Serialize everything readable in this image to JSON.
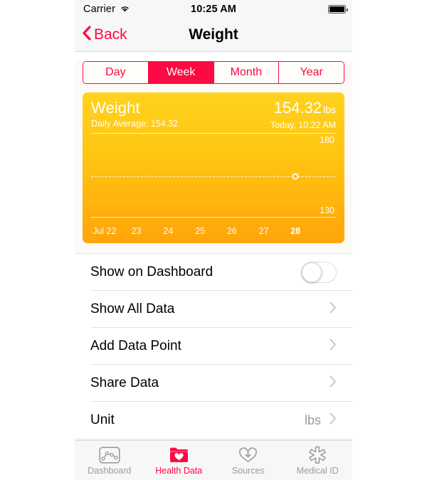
{
  "status_bar": {
    "carrier": "Carrier",
    "wifi_icon": "wifi-icon",
    "time": "10:25 AM",
    "battery_icon": "battery-full-icon"
  },
  "nav": {
    "back_label": "Back",
    "back_icon": "chevron-left-icon",
    "title": "Weight"
  },
  "segmented_control": {
    "selected": "Week",
    "options": [
      {
        "label": "Day"
      },
      {
        "label": "Week"
      },
      {
        "label": "Month"
      },
      {
        "label": "Year"
      }
    ]
  },
  "chart_card": {
    "title": "Weight",
    "subtitle": "Daily Average: 154.32",
    "value": "154.32",
    "unit": "lbs",
    "timestamp": "Today, 10:22 AM"
  },
  "chart_data": {
    "type": "scatter",
    "title": "Weight",
    "xlabel": "",
    "ylabel": "lbs",
    "ylim": [
      130,
      180
    ],
    "ytick_labels": [
      "180",
      "130"
    ],
    "grid": false,
    "categories": [
      "Jul 22",
      "23",
      "24",
      "25",
      "26",
      "27",
      "28"
    ],
    "current_category": "28",
    "average_line": 154.32,
    "series": [
      {
        "name": "Weight",
        "points": [
          {
            "x": "28",
            "y": 154.32
          }
        ]
      }
    ]
  },
  "list": {
    "rows": [
      {
        "label": "Show on Dashboard",
        "control": "toggle",
        "value": "off"
      },
      {
        "label": "Show All Data",
        "control": "chevron",
        "value": ""
      },
      {
        "label": "Add Data Point",
        "control": "chevron",
        "value": ""
      },
      {
        "label": "Share Data",
        "control": "chevron",
        "value": ""
      },
      {
        "label": "Unit",
        "control": "chevron",
        "value": "lbs"
      }
    ]
  },
  "tab_bar": {
    "selected": "Health Data",
    "tabs": [
      {
        "label": "Dashboard",
        "icon": "dashboard-chart-icon"
      },
      {
        "label": "Health Data",
        "icon": "folder-heart-icon"
      },
      {
        "label": "Sources",
        "icon": "heart-download-icon"
      },
      {
        "label": "Medical ID",
        "icon": "star-of-life-icon"
      }
    ]
  },
  "colors": {
    "accent_red": "#fb0a43",
    "chart_top": "#ffd21e",
    "chart_bottom": "#ffa40a",
    "inactive_gray": "#9b9b9b"
  }
}
